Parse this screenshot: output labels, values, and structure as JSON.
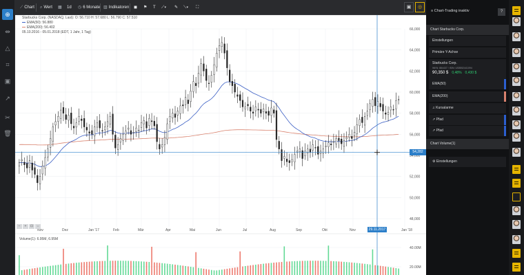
{
  "toolbar": {
    "chart": "Chart",
    "wert": "Wert",
    "interval": "1d",
    "range": "6 Monate",
    "indicators": "Indikatoren"
  },
  "chart_info": {
    "title": "Starbucks Corp. (NASDAQ, Last): O: 56.710 H: 57.680 L: 56.790 C: 57.510",
    "ema50": "EMA(50): 56.880",
    "ema200": "EMA(200): 56.402",
    "dates": "05.10.2016 - 05.01.2018 (EDT, 1 Jahr, 1 Tag)",
    "volume": "Volume(1): 6.95M, 6.95M",
    "price_marker": "54,282",
    "date_marker": "29.11.2017"
  },
  "right_panel": {
    "header": "Chart-Trading inaktiv",
    "help": "?",
    "section_chart": "Chart Starbucks Corp.",
    "settings": "Einstellungen",
    "primary_axis": "Primäre Y-Achse",
    "quote": {
      "name": "Starbucks Corp.",
      "ids": "WKN: 884437 / ISIN: US8552441094",
      "price": "90,350 $",
      "change_pct": "0,48%",
      "change_abs": "0,430 $"
    },
    "ema50": "EMA(50)",
    "ema200": "EMA(200)",
    "alarms": "Kursalarme",
    "path1": "Pfad",
    "path2": "Pfad",
    "section_volume": "Chart Volume(1)",
    "settings2": "Einstellungen"
  },
  "colors": {
    "accent": "#2c7fc9",
    "ema50": "#3b5fc4",
    "ema200": "#d9826e",
    "up": "#2ecc71",
    "down": "#e74c3c",
    "highlight": "#e5b400"
  },
  "chart_data": {
    "type": "candlestick",
    "y_ticks": [
      "66,000",
      "64,000",
      "62,000",
      "60,000",
      "58,000",
      "56,000",
      "54,000",
      "52,000",
      "50,000",
      "48,000"
    ],
    "x_ticks": [
      "Nov",
      "Dez",
      "Jan '17",
      "Feb",
      "Mär",
      "Apr",
      "Mai",
      "Jun",
      "Jul",
      "Aug",
      "Sep",
      "Okt",
      "Nov",
      "Jan '18"
    ],
    "volume_ticks": [
      "40.00M",
      "20.00M"
    ],
    "ylim": [
      47,
      67.5
    ],
    "close": [
      53.3,
      53.6,
      53.1,
      52.8,
      53.5,
      52.6,
      52.2,
      51.4,
      52.0,
      53.0,
      53.8,
      54.6,
      55.6,
      56.7,
      57.2,
      57.7,
      58.3,
      58.0,
      57.4,
      57.8,
      57.0,
      56.6,
      57.1,
      57.7,
      57.3,
      56.7,
      56.4,
      56.1,
      56.0,
      56.7,
      57.1,
      56.6,
      56.3,
      56.7,
      57.2,
      57.7,
      56.0,
      54.7,
      55.0,
      55.6,
      56.0,
      56.3,
      56.6,
      56.0,
      56.2,
      56.6,
      56.4,
      57.1,
      57.3,
      56.6,
      57.5,
      57.2,
      56.8,
      55.3,
      54.6,
      55.0,
      55.7,
      57.0,
      57.7,
      58.0,
      57.6,
      58.2,
      58.7,
      58.7,
      59.5,
      58.9,
      60.1,
      61.0,
      60.6,
      61.8,
      62.7,
      62.0,
      61.1,
      60.8,
      61.6,
      62.6,
      63.7,
      64.4,
      64.7,
      63.7,
      62.3,
      61.0,
      60.6,
      60.0,
      59.6,
      59.2,
      58.6,
      58.6,
      58.7,
      58.2,
      58.0,
      58.6,
      58.3,
      58.0,
      58.4,
      58.0,
      57.8,
      58.5,
      58.0,
      55.5,
      54.6,
      53.5,
      53.9,
      53.4,
      53.3,
      53.6,
      54.1,
      54.4,
      54.6,
      53.7,
      54.4,
      54.6,
      54.3,
      55.0,
      54.7,
      54.1,
      54.4,
      54.6,
      54.9,
      55.2,
      55.0,
      55.3,
      55.6,
      55.4,
      55.1,
      55.4,
      55.7,
      56.0,
      55.6,
      56.2,
      56.9,
      57.4,
      57.1,
      57.7,
      58.2,
      58.9,
      59.3,
      58.7,
      59.1,
      58.6,
      58.2,
      57.9,
      58.1,
      58.6,
      58.3,
      59.2,
      59.3
    ]
  }
}
